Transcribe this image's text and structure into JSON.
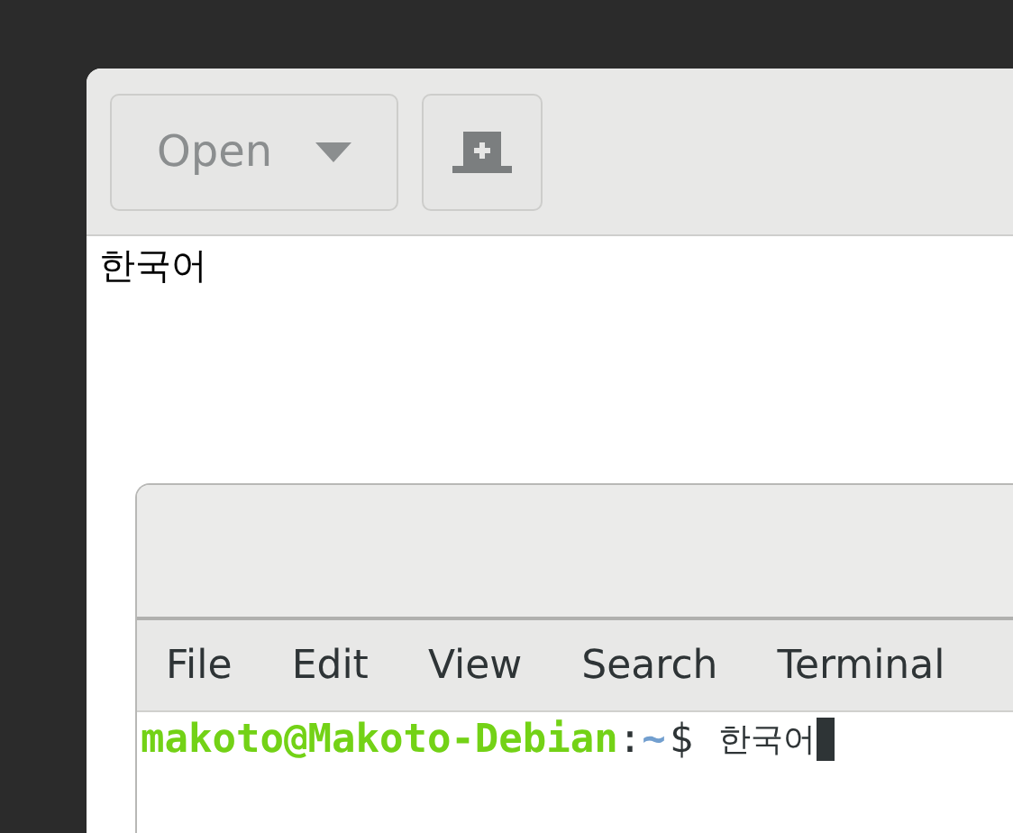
{
  "editor": {
    "open_button": {
      "label": "Open"
    },
    "document_text": "한국어"
  },
  "terminal": {
    "menu": [
      {
        "label": "File"
      },
      {
        "label": "Edit"
      },
      {
        "label": "View"
      },
      {
        "label": "Search"
      },
      {
        "label": "Terminal"
      }
    ],
    "prompt": {
      "user_host": "makoto@Makoto-Debian",
      "separator": ":",
      "path": "~",
      "symbol": "$",
      "input": "한국어"
    }
  }
}
